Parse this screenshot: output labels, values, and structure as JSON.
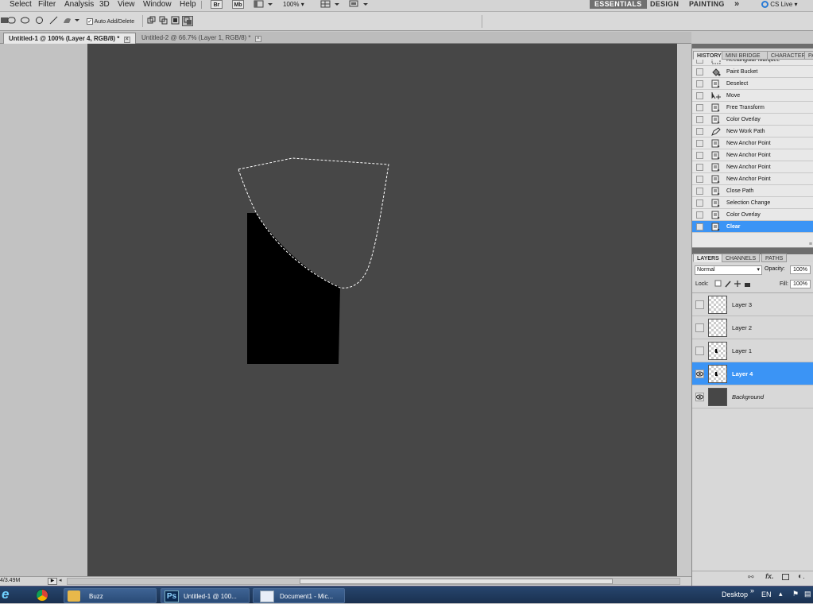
{
  "menubar": {
    "items": [
      "Select",
      "Filter",
      "Analysis",
      "3D",
      "View",
      "Window",
      "Help"
    ],
    "bridge_btn": "Br",
    "minibridge_btn": "Mb",
    "zoom": "100%",
    "workspaces": [
      "ESSENTIALS",
      "DESIGN",
      "PAINTING"
    ],
    "more": "»",
    "cs_live": "CS Live"
  },
  "options": {
    "auto_add_delete": "Auto Add/Delete",
    "auto_add_delete_checked": true
  },
  "tabs": [
    {
      "label": "Untitled-1 @ 100% (Layer 4, RGB/8) *",
      "active": true
    },
    {
      "label": "Untitled-2 @ 66.7% (Layer 1, RGB/8) *",
      "active": false
    }
  ],
  "canvas": {
    "background": "#474747",
    "shape_color": "#000000"
  },
  "status": {
    "doc_size": "4/3.49M"
  },
  "history": {
    "tabs": [
      "HISTORY",
      "MINI BRIDGE",
      "CHARACTER",
      "PA"
    ],
    "partial_item": "Rectangular Marquee",
    "items": [
      {
        "label": "Paint Bucket",
        "icon": "paint-bucket-icon"
      },
      {
        "label": "Deselect",
        "icon": "history-state-icon"
      },
      {
        "label": "Move",
        "icon": "move-icon"
      },
      {
        "label": "Free Transform",
        "icon": "history-state-icon"
      },
      {
        "label": "Color Overlay",
        "icon": "history-state-icon"
      },
      {
        "label": "New Work Path",
        "icon": "pen-icon"
      },
      {
        "label": "New Anchor Point",
        "icon": "history-state-icon"
      },
      {
        "label": "New Anchor Point",
        "icon": "history-state-icon"
      },
      {
        "label": "New Anchor Point",
        "icon": "history-state-icon"
      },
      {
        "label": "New Anchor Point",
        "icon": "history-state-icon"
      },
      {
        "label": "Close Path",
        "icon": "history-state-icon"
      },
      {
        "label": "Selection Change",
        "icon": "history-state-icon"
      },
      {
        "label": "Color Overlay",
        "icon": "history-state-icon"
      },
      {
        "label": "Clear",
        "icon": "history-state-icon",
        "selected": true
      }
    ]
  },
  "layers": {
    "tabs": [
      "LAYERS",
      "CHANNELS",
      "PATHS"
    ],
    "blend_mode": "Normal",
    "opacity_label": "Opacity:",
    "opacity_value": "100%",
    "lock_label": "Lock:",
    "fill_label": "Fill:",
    "fill_value": "100%",
    "items": [
      {
        "name": "Layer 3",
        "visible": false,
        "selected": false
      },
      {
        "name": "Layer 2",
        "visible": false,
        "selected": false
      },
      {
        "name": "Layer 1",
        "visible": false,
        "selected": false
      },
      {
        "name": "Layer 4",
        "visible": true,
        "selected": true
      },
      {
        "name": "Background",
        "visible": true,
        "selected": false,
        "italic": true
      }
    ]
  },
  "taskbar": {
    "items": [
      "Buzz",
      "Untitled-1 @ 100...",
      "Document1 - Mic..."
    ],
    "desktop_label": "Desktop",
    "lang": "EN"
  }
}
